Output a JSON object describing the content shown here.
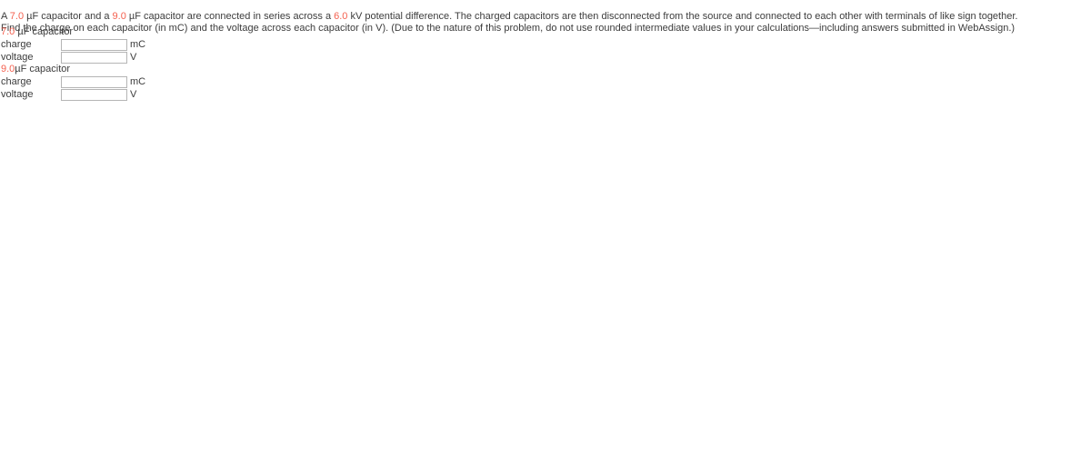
{
  "problem": {
    "segments": [
      {
        "text": "A ",
        "highlight": false
      },
      {
        "text": "7.0",
        "highlight": true
      },
      {
        "text": " µF capacitor and a ",
        "highlight": false
      },
      {
        "text": "9.0",
        "highlight": true
      },
      {
        "text": " µF capacitor are connected in series across a ",
        "highlight": false
      },
      {
        "text": "6.0",
        "highlight": true
      },
      {
        "text": " kV potential difference. The charged capacitors are then disconnected from the source and connected to each other with terminals of like sign together. Find the charge on each capacitor (in mC) and the voltage across each capacitor (in V). (Due to the nature of this problem, do not use rounded intermediate values in your calculations—including answers submitted in WebAssign.)",
        "highlight": false
      }
    ],
    "full_text": "A 7.0 µF capacitor and a 9.0 µF capacitor are connected in series across a 6.0 kV potential difference. The charged capacitors are then disconnected from the source and connected to each other with terminals of like sign together. Find the charge on each capacitor (in mC) and the voltage across each capacitor (in V). (Due to the nature of this problem, do not use rounded intermediate values in your calculations—including answers submitted in WebAssign.)"
  },
  "colors": {
    "highlight": "#f4604f",
    "text": "#3c3c3c",
    "input_border": "#b5b5b5",
    "background": "#ffffff"
  },
  "answer_groups": [
    {
      "heading_value": "7.0",
      "heading_rest": " µF capacitor",
      "fields": [
        {
          "label": "charge",
          "value": "",
          "placeholder": "",
          "unit": "mC"
        },
        {
          "label": "voltage",
          "value": "",
          "placeholder": "",
          "unit": "V"
        }
      ]
    },
    {
      "heading_value": "9.0",
      "heading_rest": "µF capacitor",
      "fields": [
        {
          "label": "charge",
          "value": "",
          "placeholder": "",
          "unit": "mC"
        },
        {
          "label": "voltage",
          "value": "",
          "placeholder": "",
          "unit": "V"
        }
      ]
    }
  ]
}
